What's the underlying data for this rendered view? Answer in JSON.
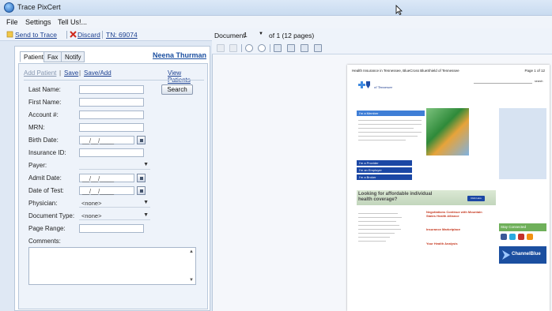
{
  "window": {
    "title": "Trace PixCert"
  },
  "menu": [
    "File",
    "Settings",
    "Tell Us!..."
  ],
  "toolbar": {
    "send": "Send to Trace",
    "discard": "Discard",
    "tn": "TN: 69074"
  },
  "tabs": [
    "Patient",
    "Fax",
    "Notify"
  ],
  "user": "Neena Thurman",
  "actions": {
    "add": "Add Patient",
    "save": "Save",
    "save_add": "Save/Add",
    "view": "View Patients"
  },
  "search_button": "Search",
  "fields": {
    "last_name": "Last Name:",
    "first_name": "First Name:",
    "account": "Account #:",
    "mrn": "MRN:",
    "birth_date": "Birth Date:",
    "insurance": "Insurance ID:",
    "payer": "Payer:",
    "admit_date": "Admit Date:",
    "date_of_test": "Date of Test:",
    "physician": "Physician:",
    "document_type": "Document Type:",
    "page_range": "Page Range:",
    "comments": "Comments:"
  },
  "values": {
    "date_mask": "__/__/____",
    "physician": "<none>",
    "document_type": "<none>"
  },
  "doc_toolbar": {
    "label": "Document",
    "doc_num": "1",
    "of_pages": "of 1 (12 pages)"
  },
  "page": {
    "header_left": "Health Insurance in Tennessee, BlueCross BlueShield of Tennessee",
    "header_right": "Page 1 of 12",
    "logo_text": "of Tennessee",
    "go": "search",
    "im_member": "I'm a Member",
    "im_provider": "I'm a Provider",
    "im_employer": "I'm an Employer",
    "im_broker": "I'm a Broker",
    "teamblue": "TeamBlue",
    "afford": "Looking for affordable individual health coverage?",
    "click_here": "Click Here",
    "neg_title": "Negotiations Continue with Mountain States Health Alliance",
    "market_title": "Insurance Marketplace",
    "health_title": "Your Health Analysis",
    "stay": "Stay Connected",
    "channel": "ChannelBlue"
  }
}
